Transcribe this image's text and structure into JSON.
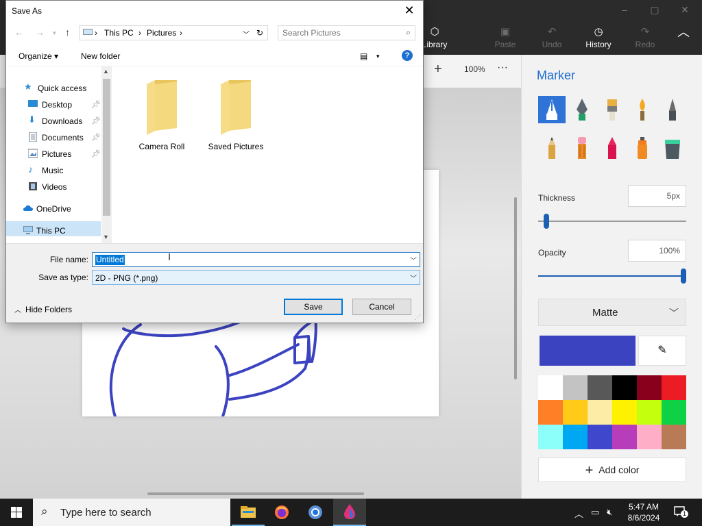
{
  "app": {
    "toolbar": {
      "library": "Library",
      "paste": "Paste",
      "undo": "Undo",
      "history": "History",
      "redo": "Redo"
    },
    "zoom": "100%",
    "side_panel": {
      "title": "Marker",
      "brushes": [
        "marker",
        "calligraphy-pen",
        "oil-brush",
        "watercolor",
        "pixel-pen",
        "pencil",
        "eraser",
        "crayon",
        "spray-can",
        "fill"
      ],
      "thickness_label": "Thickness",
      "thickness_value": "5px",
      "thickness_fraction": 0.05,
      "opacity_label": "Opacity",
      "opacity_value": "100%",
      "opacity_fraction": 1.0,
      "finish": "Matte",
      "current_color": "#3c43c0",
      "palette": [
        "#ffffff",
        "#c3c3c3",
        "#585858",
        "#000000",
        "#88001b",
        "#ec1c24",
        "#ff7f27",
        "#ffca18",
        "#fdeca6",
        "#fff200",
        "#c4ff0e",
        "#0ed145",
        "#8cfffb",
        "#00a8f3",
        "#3f48cc",
        "#b83dba",
        "#ffaec8",
        "#b97a56"
      ],
      "add_color": "Add color"
    }
  },
  "dialog": {
    "title": "Save As",
    "breadcrumb": [
      "This PC",
      "Pictures"
    ],
    "search_placeholder": "Search Pictures",
    "organize": "Organize ▾",
    "new_folder": "New folder",
    "nav": {
      "quick_access": "Quick access",
      "desktop": "Desktop",
      "downloads": "Downloads",
      "documents": "Documents",
      "pictures": "Pictures",
      "music": "Music",
      "videos": "Videos",
      "onedrive": "OneDrive",
      "this_pc": "This PC"
    },
    "folders": [
      "Camera Roll",
      "Saved Pictures"
    ],
    "file_name_label": "File name:",
    "file_name_value": "Untitled",
    "save_type_label": "Save as type:",
    "save_type_value": "2D - PNG (*.png)",
    "hide_folders": "Hide Folders",
    "save": "Save",
    "cancel": "Cancel"
  },
  "taskbar": {
    "search_placeholder": "Type here to search",
    "time": "5:47 AM",
    "date": "8/6/2024",
    "notification_count": "1"
  }
}
